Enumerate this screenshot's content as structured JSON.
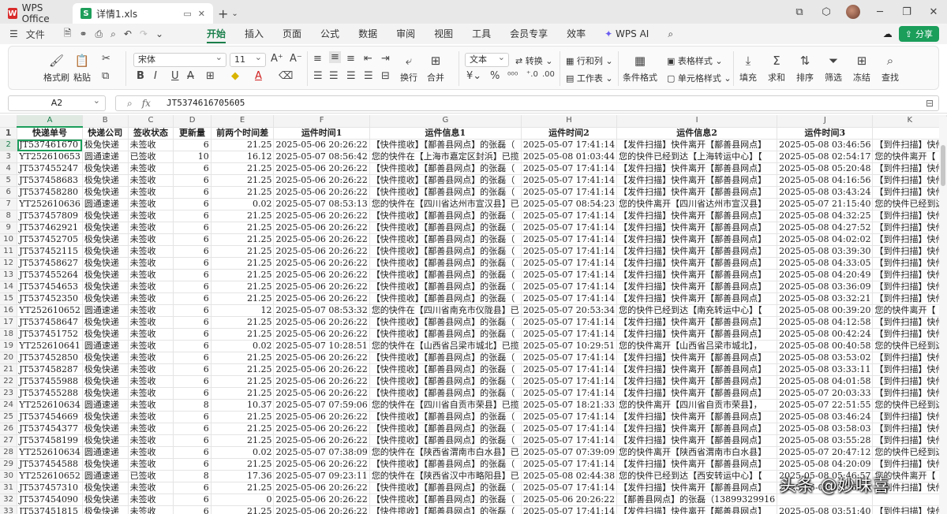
{
  "titlebar": {
    "app_tab": "WPS Office",
    "file_tab": "详情1.xls",
    "new_tab": "+"
  },
  "menubar": {
    "file_menu": "文件",
    "tabs": [
      "开始",
      "插入",
      "页面",
      "公式",
      "数据",
      "审阅",
      "视图",
      "工具",
      "会员专享",
      "效率"
    ],
    "ai_label": "WPS AI",
    "share_label": "分享"
  },
  "ribbon": {
    "format_painter": "格式刷",
    "paste": "粘贴",
    "font_name": "宋体",
    "font_size": "11",
    "wrap": "换行",
    "merge": "合并",
    "number_format": "文本",
    "convert": "转换",
    "rows_cols": "行和列",
    "worksheet": "工作表",
    "cond_format": "条件格式",
    "table_style": "表格样式",
    "cell_style": "单元格样式",
    "fill": "填充",
    "sum": "求和",
    "sort": "排序",
    "filter": "筛选",
    "freeze": "冻结",
    "find": "查找"
  },
  "formula_bar": {
    "cell_ref": "A2",
    "fx": "fx",
    "value": "JT5374616705605"
  },
  "sheet": {
    "columns": [
      "A",
      "B",
      "C",
      "D",
      "E",
      "F",
      "G",
      "H",
      "I",
      "J",
      "K"
    ],
    "headers": [
      "快递单号",
      "快递公司",
      "签收状态",
      "更新量",
      "前两个时间差",
      "运件时间1",
      "运件信息1",
      "运件时间2",
      "运件信息2",
      "运件时间3",
      ""
    ],
    "rows": [
      [
        "JT537461670",
        "极兔快递",
        "未签收",
        "6",
        "21.25",
        "2025-05-06 20:26:22",
        "【快件揽收】【鄯善县网点】的张磊（",
        "2025-05-07 17:41:14",
        "【发件扫描】快件离开【鄯善县网点】",
        "2025-05-08 03:46:56",
        "【到件扫描】快件"
      ],
      [
        "YT252610653",
        "圆通速递",
        "已签收",
        "10",
        "16.12",
        "2025-05-07 08:56:42",
        "您的快件在【上海市嘉定区封浜】已揽",
        "2025-05-08 01:03:44",
        "您的快件已经到达【上海转运中心】【",
        "2025-05-08 02:54:17",
        "您的快件离开【"
      ],
      [
        "JT537455247",
        "极兔快递",
        "未签收",
        "6",
        "21.25",
        "2025-05-06 20:26:22",
        "【快件揽收】【鄯善县网点】的张磊（",
        "2025-05-07 17:41:14",
        "【发件扫描】快件离开【鄯善县网点】",
        "2025-05-08 05:20:48",
        "【到件扫描】快件"
      ],
      [
        "JT537458683",
        "极兔快递",
        "未签收",
        "6",
        "21.25",
        "2025-05-06 20:26:22",
        "【快件揽收】【鄯善县网点】的张磊（",
        "2025-05-07 17:41:14",
        "【发件扫描】快件离开【鄯善县网点】",
        "2025-05-08 04:16:56",
        "【到件扫描】快件"
      ],
      [
        "JT537458280",
        "极兔快递",
        "未签收",
        "6",
        "21.25",
        "2025-05-06 20:26:22",
        "【快件揽收】【鄯善县网点】的张磊（",
        "2025-05-07 17:41:14",
        "【发件扫描】快件离开【鄯善县网点】",
        "2025-05-08 03:43:24",
        "【到件扫描】快件"
      ],
      [
        "YT252610636",
        "圆通速递",
        "未签收",
        "6",
        "0.02",
        "2025-05-07 08:53:13",
        "您的快件在【四川省达州市宣汉县】已",
        "2025-05-07 08:54:23",
        "您的快件离开【四川省达州市宣汉县】",
        "2025-05-07 21:15:40",
        "您的快件已经到达"
      ],
      [
        "JT537457809",
        "极兔快递",
        "未签收",
        "6",
        "21.25",
        "2025-05-06 20:26:22",
        "【快件揽收】【鄯善县网点】的张磊（",
        "2025-05-07 17:41:14",
        "【发件扫描】快件离开【鄯善县网点】",
        "2025-05-08 04:32:25",
        "【到件扫描】快件"
      ],
      [
        "JT537462921",
        "极兔快递",
        "未签收",
        "6",
        "21.25",
        "2025-05-06 20:26:22",
        "【快件揽收】【鄯善县网点】的张磊（",
        "2025-05-07 17:41:14",
        "【发件扫描】快件离开【鄯善县网点】",
        "2025-05-08 04:27:52",
        "【到件扫描】快件"
      ],
      [
        "JT537452705",
        "极兔快递",
        "未签收",
        "6",
        "21.25",
        "2025-05-06 20:26:22",
        "【快件揽收】【鄯善县网点】的张磊（",
        "2025-05-07 17:41:14",
        "【发件扫描】快件离开【鄯善县网点】",
        "2025-05-08 04:02:02",
        "【到件扫描】快件"
      ],
      [
        "JT537452115",
        "极兔快递",
        "未签收",
        "6",
        "21.25",
        "2025-05-06 20:26:22",
        "【快件揽收】【鄯善县网点】的张磊（",
        "2025-05-07 17:41:14",
        "【发件扫描】快件离开【鄯善县网点】",
        "2025-05-08 03:39:30",
        "【到件扫描】快件"
      ],
      [
        "JT537458627",
        "极兔快递",
        "未签收",
        "6",
        "21.25",
        "2025-05-06 20:26:22",
        "【快件揽收】【鄯善县网点】的张磊（",
        "2025-05-07 17:41:14",
        "【发件扫描】快件离开【鄯善县网点】",
        "2025-05-08 04:33:05",
        "【到件扫描】快件"
      ],
      [
        "JT537455264",
        "极兔快递",
        "未签收",
        "6",
        "21.25",
        "2025-05-06 20:26:22",
        "【快件揽收】【鄯善县网点】的张磊（",
        "2025-05-07 17:41:14",
        "【发件扫描】快件离开【鄯善县网点】",
        "2025-05-08 04:20:49",
        "【到件扫描】快件"
      ],
      [
        "JT537454653",
        "极兔快递",
        "未签收",
        "6",
        "21.25",
        "2025-05-06 20:26:22",
        "【快件揽收】【鄯善县网点】的张磊（",
        "2025-05-07 17:41:14",
        "【发件扫描】快件离开【鄯善县网点】",
        "2025-05-08 03:36:09",
        "【到件扫描】快件"
      ],
      [
        "JT537452350",
        "极兔快递",
        "未签收",
        "6",
        "21.25",
        "2025-05-06 20:26:22",
        "【快件揽收】【鄯善县网点】的张磊（",
        "2025-05-07 17:41:14",
        "【发件扫描】快件离开【鄯善县网点】",
        "2025-05-08 03:32:21",
        "【到件扫描】快件"
      ],
      [
        "YT252610652",
        "圆通速递",
        "未签收",
        "6",
        "12",
        "2025-05-07 08:53:32",
        "您的快件在【四川省南充市仪陇县】已",
        "2025-05-07 20:53:34",
        "您的快件已经到达【南充转运中心】【",
        "2025-05-08 00:39:20",
        "您的快件离开【"
      ],
      [
        "JT537458647",
        "极兔快递",
        "未签收",
        "6",
        "21.25",
        "2025-05-06 20:26:22",
        "【快件揽收】【鄯善县网点】的张磊（",
        "2025-05-07 17:41:14",
        "【发件扫描】快件离开【鄯善县网点】",
        "2025-05-08 04:12:58",
        "【到件扫描】快件"
      ],
      [
        "JT537451752",
        "极兔快递",
        "未签收",
        "6",
        "21.25",
        "2025-05-06 20:26:22",
        "【快件揽收】【鄯善县网点】的张磊（",
        "2025-05-07 17:41:14",
        "【发件扫描】快件离开【鄯善县网点】",
        "2025-05-08 00:42:24",
        "【到件扫描】快件"
      ],
      [
        "YT252610641",
        "圆通速递",
        "未签收",
        "6",
        "0.02",
        "2025-05-07 10:28:51",
        "您的快件在【山西省吕梁市城北】已揽",
        "2025-05-07 10:29:51",
        "您的快件离开【山西省吕梁市城北】，",
        "2025-05-08 00:40:58",
        "您的快件已经到达"
      ],
      [
        "JT537452850",
        "极兔快递",
        "未签收",
        "6",
        "21.25",
        "2025-05-06 20:26:22",
        "【快件揽收】【鄯善县网点】的张磊（",
        "2025-05-07 17:41:14",
        "【发件扫描】快件离开【鄯善县网点】",
        "2025-05-08 03:53:02",
        "【到件扫描】快件"
      ],
      [
        "JT537458287",
        "极兔快递",
        "未签收",
        "6",
        "21.25",
        "2025-05-06 20:26:22",
        "【快件揽收】【鄯善县网点】的张磊（",
        "2025-05-07 17:41:14",
        "【发件扫描】快件离开【鄯善县网点】",
        "2025-05-08 03:33:11",
        "【到件扫描】快件"
      ],
      [
        "JT537455988",
        "极兔快递",
        "未签收",
        "6",
        "21.25",
        "2025-05-06 20:26:22",
        "【快件揽收】【鄯善县网点】的张磊（",
        "2025-05-07 17:41:14",
        "【发件扫描】快件离开【鄯善县网点】",
        "2025-05-08 04:01:58",
        "【到件扫描】快件"
      ],
      [
        "JT537455288",
        "极兔快递",
        "未签收",
        "6",
        "21.25",
        "2025-05-06 20:26:22",
        "【快件揽收】【鄯善县网点】的张磊（",
        "2025-05-07 17:41:14",
        "【发件扫描】快件离开【鄯善县网点】",
        "2025-05-07 20:03:33",
        "【到件扫描】快件"
      ],
      [
        "YT252610634",
        "圆通速递",
        "未签收",
        "8",
        "10.37",
        "2025-05-07 07:59:06",
        "您的快件在【四川省自贡市荣县】已揽",
        "2025-05-07 18:21:33",
        "您的快件离开【四川省自贡市荣县】，",
        "2025-05-07 22:51:55",
        "您的快件已经到达"
      ],
      [
        "JT537454669",
        "极兔快递",
        "未签收",
        "6",
        "21.25",
        "2025-05-06 20:26:22",
        "【快件揽收】【鄯善县网点】的张磊（",
        "2025-05-07 17:41:14",
        "【发件扫描】快件离开【鄯善县网点】",
        "2025-05-08 03:46:24",
        "【到件扫描】快件"
      ],
      [
        "JT537454377",
        "极兔快递",
        "未签收",
        "6",
        "21.25",
        "2025-05-06 20:26:22",
        "【快件揽收】【鄯善县网点】的张磊（",
        "2025-05-07 17:41:14",
        "【发件扫描】快件离开【鄯善县网点】",
        "2025-05-08 03:58:03",
        "【到件扫描】快件"
      ],
      [
        "JT537458199",
        "极兔快递",
        "未签收",
        "6",
        "21.25",
        "2025-05-06 20:26:22",
        "【快件揽收】【鄯善县网点】的张磊（",
        "2025-05-07 17:41:14",
        "【发件扫描】快件离开【鄯善县网点】",
        "2025-05-08 03:55:28",
        "【到件扫描】快件"
      ],
      [
        "YT252610634",
        "圆通速递",
        "未签收",
        "6",
        "0.02",
        "2025-05-07 07:38:09",
        "您的快件在【陕西省渭南市白水县】已",
        "2025-05-07 07:39:09",
        "您的快件离开【陕西省渭南市白水县】",
        "2025-05-07 20:47:12",
        "您的快件已经到达"
      ],
      [
        "JT537454588",
        "极兔快递",
        "未签收",
        "6",
        "21.25",
        "2025-05-06 20:26:22",
        "【快件揽收】【鄯善县网点】的张磊（",
        "2025-05-07 17:41:14",
        "【发件扫描】快件离开【鄯善县网点】",
        "2025-05-08 04:20:09",
        "【到件扫描】快件"
      ],
      [
        "YT252610652",
        "圆通速递",
        "已签收",
        "8",
        "17.36",
        "2025-05-07 09:23:11",
        "您的快件在【陕西省汉中市略阳县】已",
        "2025-05-08 02:44:38",
        "您的快件已经到达【西安转运中心】【",
        "2025-05-08 05:46:57",
        "您的快件离开【"
      ],
      [
        "JT537457310",
        "极兔快递",
        "未签收",
        "6",
        "21.25",
        "2025-05-06 20:26:22",
        "【快件揽收】【鄯善县网点】的张磊（",
        "2025-05-07 17:41:14",
        "【发件扫描】快件离开【鄯善县网点】",
        "2025-05-08 03:36:18",
        "【到件扫描】快件"
      ],
      [
        "JT537454090",
        "极兔快递",
        "未签收",
        "6",
        "0",
        "2025-05-06 20:26:22",
        "【快件揽收】【鄯善县网点】的张磊（",
        "2025-05-06 20:26:22",
        "【鄯善县网点】的张磊（13899329916",
        "",
        ""
      ],
      [
        "JT537451815",
        "极兔快递",
        "未签收",
        "6",
        "21.25",
        "2025-05-06 20:26:22",
        "【快件揽收】【鄯善县网点】的张磊（",
        "2025-05-07 17:41:14",
        "【发件扫描】快件离开【鄯善县网点】",
        "2025-05-08 03:51:40",
        "【到件扫描】快件"
      ]
    ]
  },
  "watermark": "头条 @妙味喜"
}
